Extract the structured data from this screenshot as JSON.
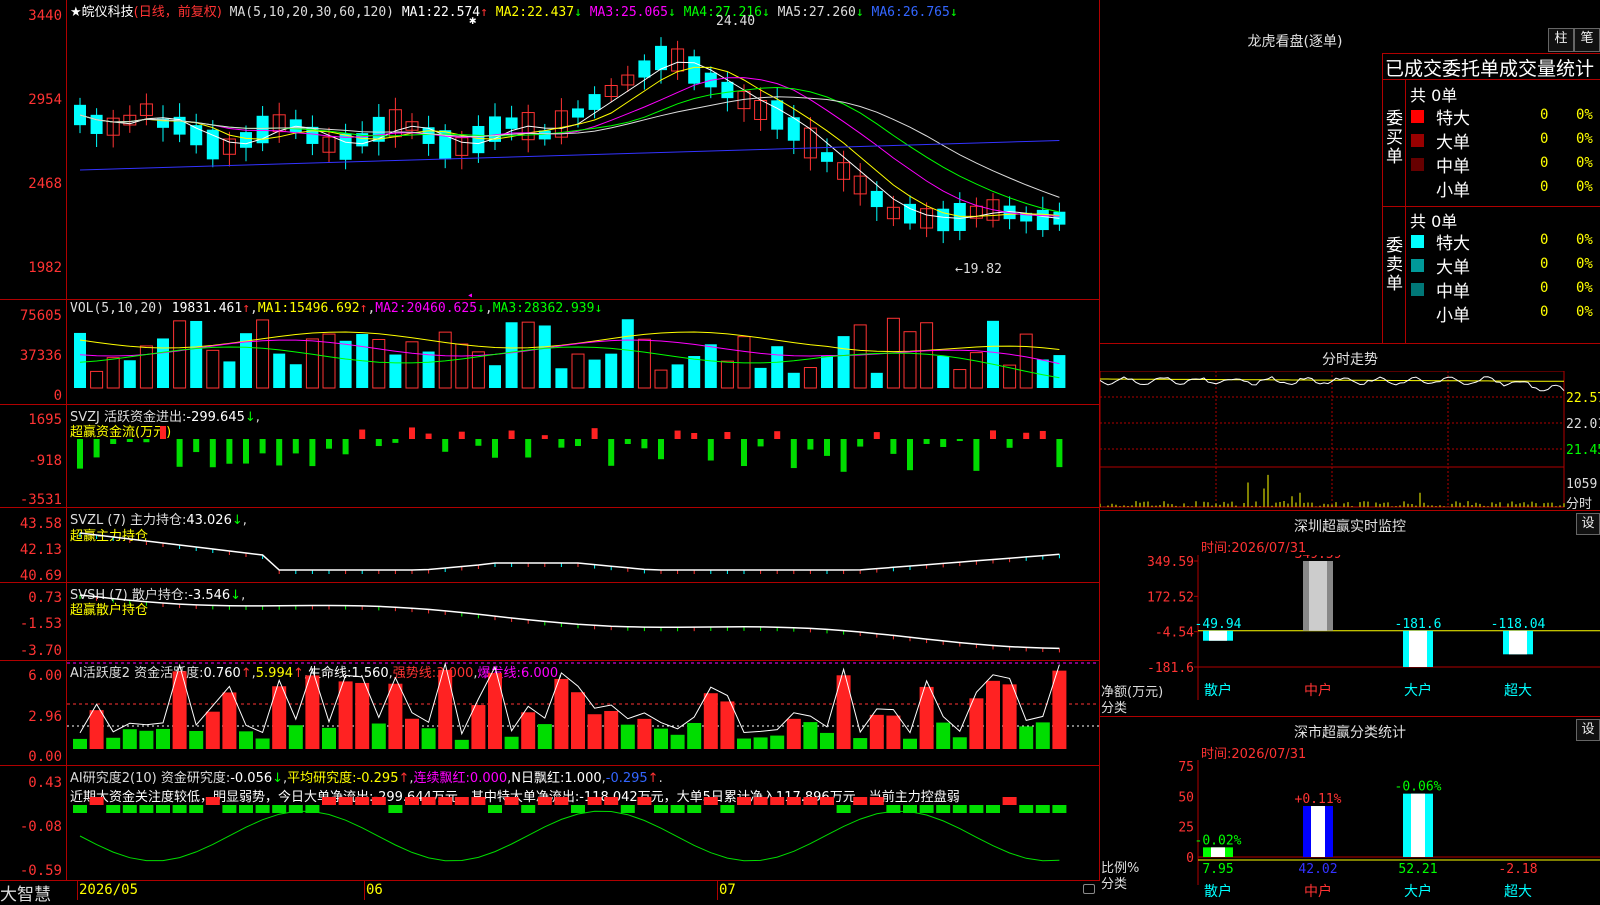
{
  "app": {
    "brand": "大智慧",
    "bottom_dates": [
      "2026/05",
      "06",
      "07"
    ]
  },
  "kline": {
    "title": "★皖仪科技",
    "period_label": "(日线，前复权)",
    "ma_spec": "MA(5,10,20,30,60,120)",
    "ma": [
      {
        "label": "MA1:",
        "value": "22.574",
        "arrow": "↑",
        "color": "#ffffff"
      },
      {
        "label": "MA2:",
        "value": "22.437",
        "arrow": "↓",
        "color": "#ffff00"
      },
      {
        "label": "MA3:",
        "value": "25.065",
        "arrow": "↓",
        "color": "#ff00ff"
      },
      {
        "label": "MA4:",
        "value": "27.216",
        "arrow": "↓",
        "color": "#00ff00"
      },
      {
        "label": "MA5:",
        "value": "27.260",
        "arrow": "↓",
        "color": "#dddddd"
      },
      {
        "label": "MA6:",
        "value": "26.765",
        "arrow": "↓",
        "color": "#3333ff"
      }
    ],
    "yticks": [
      "3440",
      "2954",
      "2468",
      "1982"
    ],
    "high_label": "24.40",
    "low_label": "←19.82"
  },
  "vol": {
    "spec": "VOL(5,10,20)",
    "value": "19831.461",
    "ma1": "15496.692",
    "ma2": "20460.625",
    "ma3": "28362.939",
    "yticks": [
      "75605",
      "37336",
      "0"
    ]
  },
  "svzj": {
    "title": "SVZJ  活跃资金进出:",
    "value": "-299.645",
    "sub": "超赢资金流(万元)",
    "yticks": [
      "1695",
      "-918",
      "-3531"
    ]
  },
  "svzl": {
    "title": "SVZL (7) 主力持仓:",
    "value": "43.026",
    "sub": "超赢主力持仓",
    "yticks": [
      "43.58",
      "42.13",
      "40.69"
    ]
  },
  "svsh": {
    "title": "SVSH (7) 散户持仓:",
    "value": "-3.546",
    "sub": "超赢散户持仓",
    "yticks": [
      "0.73",
      "-1.53",
      "-3.70"
    ]
  },
  "ai_act": {
    "title": "AI活跃度2 资金活跃度:",
    "value1": "0.760",
    "value2": "5.994",
    "life_label": "生命线:",
    "life_value": "1.560",
    "strong_label": "强势线:",
    "strong_value": "3.000",
    "burst_label": "爆发线:",
    "burst_value": "6.000",
    "yticks": [
      "6.00",
      "2.96",
      "0.00"
    ]
  },
  "ai_res": {
    "title": "AI研究度2(10) 资金研究度:",
    "value": "-0.056",
    "avg_label": "平均研究度:",
    "avg_value": "-0.295",
    "red_label": "连续飘红:",
    "red_value": "0.000",
    "nday_label": "N日飘红:",
    "nday_value": "1.000",
    "extra_value": "-0.295",
    "comment": "近期大资金关注度较低，明显弱势，今日大单净流出:-299.644万元，其中特大单净流出:-118.042万元，大单5日累计净入117.896万元，当前主力控盘弱",
    "yticks": [
      "0.43",
      "-0.08",
      "-0.59"
    ]
  },
  "longhu": {
    "title": "龙虎看盘(逐单)",
    "btn_bar": "柱",
    "btn_pen": "笔",
    "header": "已成交委托单成交量统计",
    "buy_label": "委买单",
    "sell_label": "委卖单",
    "buy_total": "共 0单",
    "sell_total": "共 0单",
    "buy_rows": [
      {
        "name": "特大",
        "count": "0",
        "pct": "0%",
        "color": "#ff0000"
      },
      {
        "name": "大单",
        "count": "0",
        "pct": "0%",
        "color": "#990000"
      },
      {
        "name": "中单",
        "count": "0",
        "pct": "0%",
        "color": "#660000"
      },
      {
        "name": "小单",
        "count": "0",
        "pct": "0%",
        "color": "#000000"
      }
    ],
    "sell_rows": [
      {
        "name": "特大",
        "count": "0",
        "pct": "0%",
        "color": "#00ffff"
      },
      {
        "name": "大单",
        "count": "0",
        "pct": "0%",
        "color": "#009999"
      },
      {
        "name": "中单",
        "count": "0",
        "pct": "0%",
        "color": "#007777"
      },
      {
        "name": "小单",
        "count": "0",
        "pct": "0%",
        "color": "#000000"
      }
    ]
  },
  "intraday": {
    "title": "分时走势",
    "prices": [
      "22.57",
      "22.01",
      "21.45"
    ],
    "vol_label": "1059",
    "vol_unit": "分时"
  },
  "sz_monitor": {
    "title": "深圳超赢实时监控",
    "set_btn": "设",
    "time_label": "时间:",
    "time_value": "2026/07/31",
    "yticks": [
      "349.59",
      "172.52",
      "-4.54",
      "-181.6"
    ],
    "ylabel1": "净额(万元)",
    "ylabel2": "分类",
    "categories": [
      "散户",
      "中户",
      "大户",
      "超大"
    ],
    "values": [
      -49.94,
      349.59,
      -181.6,
      -118.04
    ],
    "value_labels": [
      "-49.94",
      "349.59",
      "-181.6",
      "-118.04"
    ]
  },
  "sz_class": {
    "title": "深市超赢分类统计",
    "set_btn": "设",
    "time_label": "时间:",
    "time_value": "2026/07/31",
    "yticks": [
      "75",
      "50",
      "25",
      "0"
    ],
    "ylabel1": "比例%",
    "ylabel2": "分类",
    "categories": [
      "散户",
      "中户",
      "大户",
      "超大"
    ],
    "values": [
      7.95,
      42.02,
      52.21,
      -2.18
    ],
    "bottom_labels": [
      "7.95",
      "42.02",
      "52.21",
      "-2.18"
    ],
    "change_labels": [
      "-0.02%",
      "+0.11%",
      "-0.06%",
      ""
    ]
  }
}
